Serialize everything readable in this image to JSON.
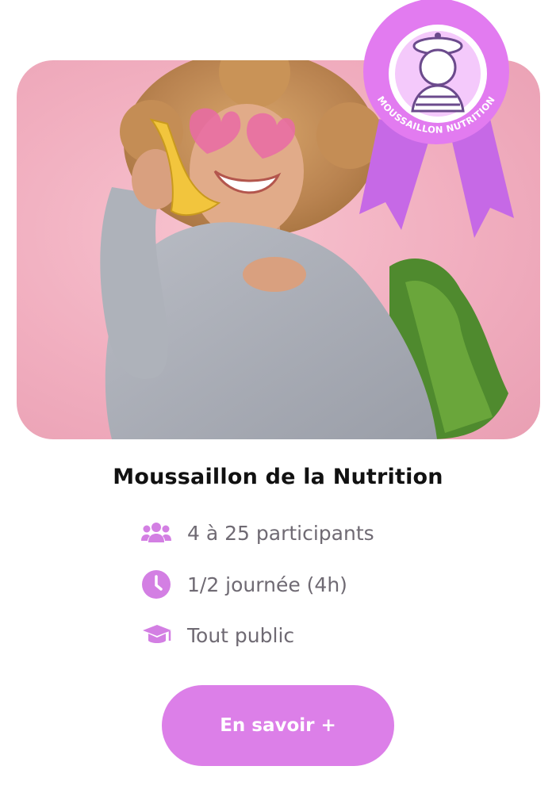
{
  "card": {
    "image_alt": "Femme souriante aux lunettes roses tenant une banane comme un téléphone",
    "badge": {
      "text": "MOUSSAILLON NUTRITION",
      "color": "#e27bf0"
    },
    "title": "Moussaillon de la Nutrition",
    "details": [
      {
        "icon": "users-icon",
        "label": "4 à 25 participants"
      },
      {
        "icon": "clock-icon",
        "label": "1/2 journée (4h)"
      },
      {
        "icon": "graduation-cap-icon",
        "label": "Tout public"
      }
    ],
    "cta_label": "En savoir +"
  },
  "colors": {
    "accent": "#dc7fe8",
    "text": "#111111",
    "muted": "#6f6a73",
    "hero_bg": "#f1aebf"
  }
}
